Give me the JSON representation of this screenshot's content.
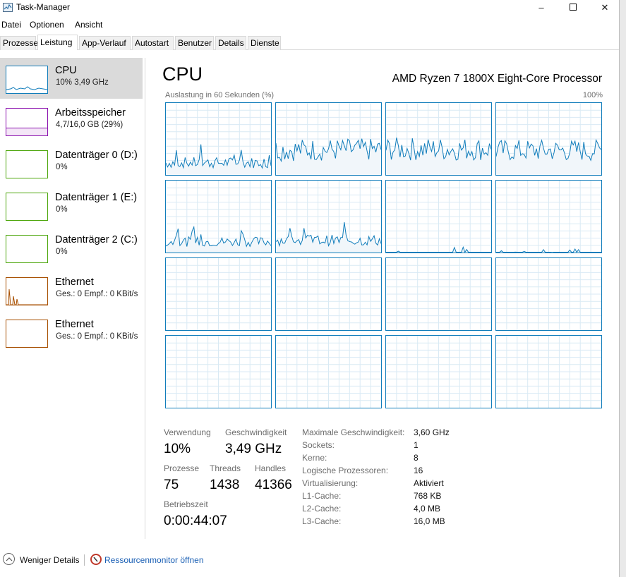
{
  "window": {
    "title": "Task-Manager",
    "minimize": "–",
    "close": "✕"
  },
  "menu": [
    "Datei",
    "Optionen",
    "Ansicht"
  ],
  "tabs": [
    "Prozesse",
    "Leistung",
    "App-Verlauf",
    "Autostart",
    "Benutzer",
    "Details",
    "Dienste"
  ],
  "active_tab": "Leistung",
  "sidebar": {
    "items": [
      {
        "name": "CPU",
        "sub": "10% 3,49 GHz",
        "color": "#117dbb",
        "selected": true
      },
      {
        "name": "Arbeitsspeicher",
        "sub": "4,7/16,0 GB (29%)",
        "color": "#8b12ae",
        "selected": false
      },
      {
        "name": "Datenträger 0 (D:)",
        "sub": "0%",
        "color": "#4da60c",
        "selected": false
      },
      {
        "name": "Datenträger 1 (E:)",
        "sub": "0%",
        "color": "#4da60c",
        "selected": false
      },
      {
        "name": "Datenträger 2 (C:)",
        "sub": "0%",
        "color": "#4da60c",
        "selected": false
      },
      {
        "name": "Ethernet",
        "sub": "Ges.: 0 Empf.: 0 KBit/s",
        "color": "#a74f01",
        "selected": false
      },
      {
        "name": "Ethernet",
        "sub": "Ges.: 0 Empf.: 0 KBit/s",
        "color": "#a74f01",
        "selected": false
      }
    ]
  },
  "main": {
    "title": "CPU",
    "model": "AMD Ryzen 7 1800X Eight-Core Processor",
    "graph_label": "Auslastung in 60 Sekunden (%)",
    "graph_max": "100%",
    "accent": "#117dbb",
    "cores_active_levels": [
      0.17,
      0.35,
      0.36,
      0.34,
      0.15,
      0.17,
      0.03,
      0.02,
      0,
      0,
      0,
      0,
      0,
      0,
      0,
      0
    ]
  },
  "stats": {
    "verwendung_label": "Verwendung",
    "verwendung": "10%",
    "geschwindigkeit_label": "Geschwindigkeit",
    "geschwindigkeit": "3,49 GHz",
    "prozesse_label": "Prozesse",
    "prozesse": "75",
    "threads_label": "Threads",
    "threads": "1438",
    "handles_label": "Handles",
    "handles": "41366",
    "betriebszeit_label": "Betriebszeit",
    "betriebszeit": "0:00:44:07"
  },
  "specs": [
    {
      "label": "Maximale Geschwindigkeit:",
      "value": "3,60 GHz"
    },
    {
      "label": "Sockets:",
      "value": "1"
    },
    {
      "label": "Kerne:",
      "value": "8"
    },
    {
      "label": "Logische Prozessoren:",
      "value": "16"
    },
    {
      "label": "Virtualisierung:",
      "value": "Aktiviert"
    },
    {
      "label": "L1-Cache:",
      "value": "768 KB"
    },
    {
      "label": "L2-Cache:",
      "value": "4,0 MB"
    },
    {
      "label": "L3-Cache:",
      "value": "16,0 MB"
    }
  ],
  "footer": {
    "fewer_details": "Weniger Details",
    "resource_monitor": "Ressourcenmonitor öffnen"
  }
}
